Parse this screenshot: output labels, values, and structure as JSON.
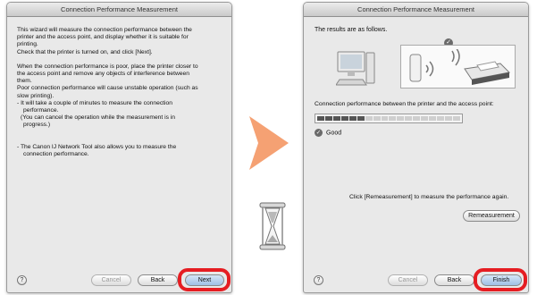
{
  "left_window": {
    "title": "Connection Performance Measurement",
    "paragraphs": [
      "This wizard will measure the connection performance between the",
      "printer and the access point, and display whether it is suitable for",
      "printing.",
      "Check that the printer is turned on, and click [Next].",
      "When the connection performance is poor, place the printer closer to",
      "the access point and remove any objects of interference between",
      "them.",
      "Poor connection performance will cause unstable operation (such as",
      "slow printing).",
      "- It will take a couple of minutes to measure the connection",
      "performance.",
      "(You can cancel the operation while the measurement is in",
      "progress.)",
      "- The Canon IJ Network Tool also allows you to measure the",
      "connection performance."
    ],
    "help_label": "?",
    "cancel_label": "Cancel",
    "back_label": "Back",
    "next_label": "Next"
  },
  "right_window": {
    "title": "Connection Performance Measurement",
    "results_label": "The results are as follows.",
    "connection_label": "Connection performance between the printer and the access point:",
    "status_label": "Good",
    "meter_level": 0.33,
    "remeasure_instruction": "Click [Remeasurement] to measure the performance again.",
    "remeasure_label": "Remeasurement",
    "help_label": "?",
    "cancel_label": "Cancel",
    "back_label": "Back",
    "finish_label": "Finish"
  },
  "colors": {
    "arrow": "#f5a173",
    "highlight_ring": "#e51d22",
    "meter_fill": "#555555",
    "meter_empty": "#cfcfcf"
  },
  "icons": [
    "arrow-right-icon",
    "hourglass-icon",
    "computer-icon",
    "access-point-icon",
    "printer-icon",
    "check-icon",
    "help-icon"
  ]
}
